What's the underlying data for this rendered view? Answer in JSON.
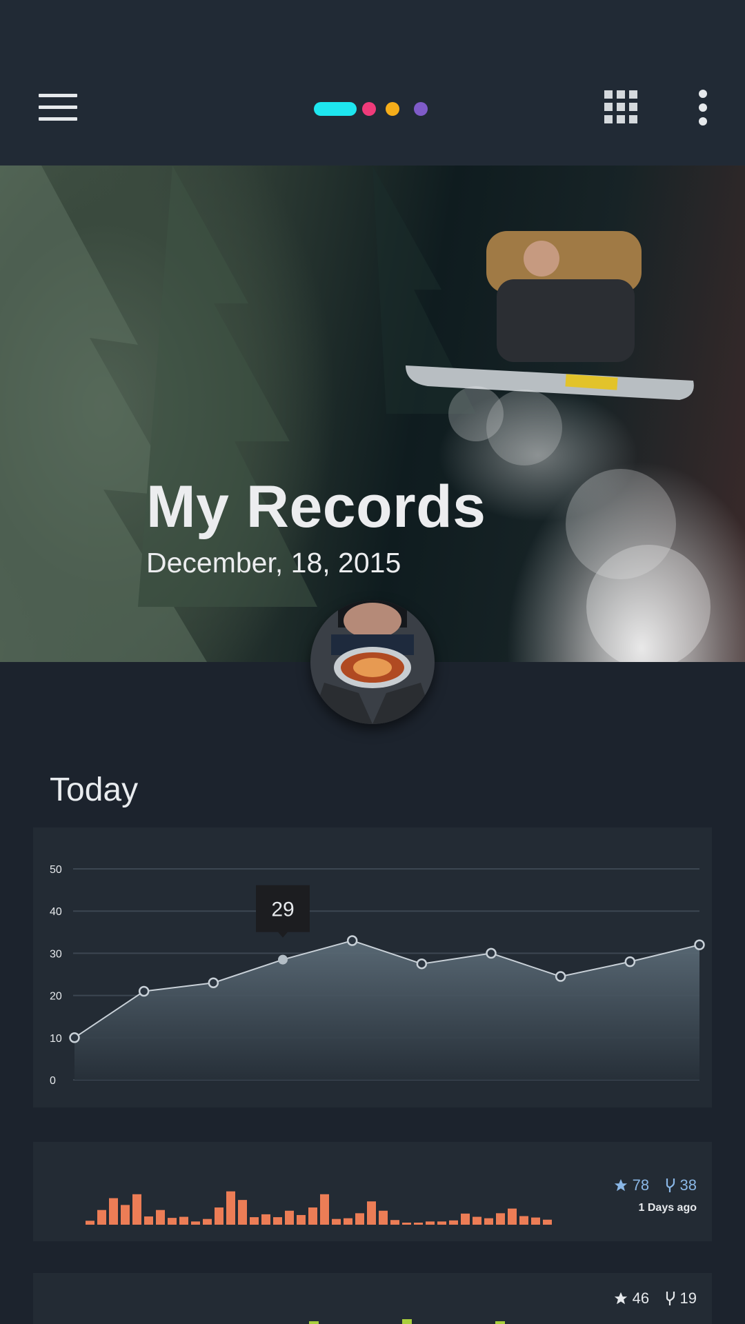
{
  "header": {
    "menu_icon": "hamburger-menu-icon",
    "page_indicator": {
      "colors": [
        "#1ee6ef",
        "#ef3b7a",
        "#f5ad1a",
        "#7f5bc8"
      ],
      "active_index": 0
    },
    "apps_icon": "apps-grid-icon",
    "more_icon": "more-vertical-icon"
  },
  "hero": {
    "title": "My Records",
    "date": "December, 18, 2015"
  },
  "today": {
    "title": "Today"
  },
  "chart_data": {
    "type": "area",
    "title": "",
    "xlabel": "",
    "ylabel": "",
    "ylim": [
      0,
      50
    ],
    "yticks": [
      0,
      10,
      20,
      30,
      40,
      50
    ],
    "grid": true,
    "points": [
      10,
      21,
      23,
      28.5,
      33,
      27.5,
      30,
      24.5,
      28,
      32
    ],
    "highlight_index": 3,
    "tooltip_value": "29",
    "colors": {
      "line": "#c9d1d8",
      "fill_top": "#5b6b77",
      "fill_bottom": "#273039",
      "grid": "#3d4752"
    }
  },
  "activity": [
    {
      "bar_color": "#ec7d56",
      "bars": [
        0.11,
        0.41,
        0.74,
        0.55,
        0.85,
        0.23,
        0.41,
        0.19,
        0.22,
        0.09,
        0.16,
        0.48,
        0.93,
        0.69,
        0.21,
        0.29,
        0.21,
        0.39,
        0.27,
        0.48,
        0.85,
        0.16,
        0.18,
        0.32,
        0.65,
        0.39,
        0.13,
        0.05,
        0.05,
        0.09,
        0.09,
        0.12,
        0.31,
        0.22,
        0.18,
        0.32,
        0.45,
        0.24,
        0.2,
        0.14
      ],
      "stars": "78",
      "forks": "38",
      "ago": "1 Days ago",
      "star_icon": "star-icon",
      "fork_icon": "fork-icon"
    },
    {
      "bar_color": "#a9cf3c",
      "stars": "46",
      "forks": "19",
      "star_icon": "star-icon",
      "fork_icon": "fork-icon"
    }
  ]
}
